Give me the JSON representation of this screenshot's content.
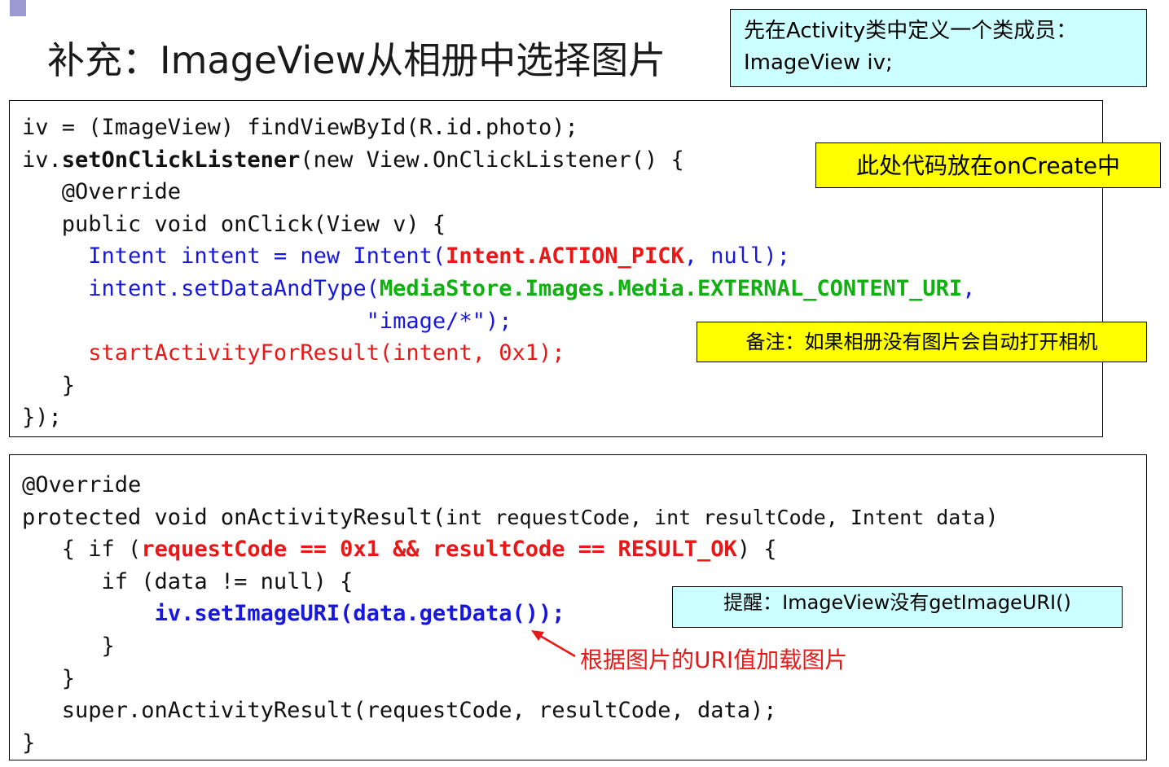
{
  "slide": {
    "title": "补充：ImageView从相册中选择图片"
  },
  "notes": {
    "member_line1": "先在Activity类中定义一个类成员：",
    "member_line2": "ImageView iv;",
    "oncreate": "此处代码放在onCreate中",
    "camera": "备注：如果相册没有图片会自动打开相机",
    "reminder": "提醒：ImageView没有getImageURI()",
    "arrow_label": "根据图片的URI值加载图片"
  },
  "code_block_1": {
    "l1": "iv = (ImageView) findViewById(R.id.photo);",
    "l2_a": "iv.",
    "l2_b": "setOnClickListener",
    "l2_c": "(new View.OnClickListener() {",
    "l3": "   @Override",
    "l4": "   public void onClick(View v) {",
    "l5_a": "     Intent intent = new Intent(",
    "l5_b": "Intent.ACTION_PICK",
    "l5_c": ", null);",
    "l6_a": "     intent.setDataAndType(",
    "l6_b": "MediaStore.Images.Media.EXTERNAL_CONTENT_URI",
    "l6_c": ",",
    "l7": "                          \"image/*\");",
    "l8": "     startActivityForResult(intent, 0x1);",
    "l9": "   }",
    "l10": "});"
  },
  "code_block_2": {
    "l1": "@Override",
    "l2_a": "protected void onActivityResult(",
    "l2_b": "int requestCode, int resultCode, Intent data",
    "l2_c": ")",
    "l3_a": "   { if (",
    "l3_b": "requestCode == 0x1 && resultCode == RESULT_OK",
    "l3_c": ") {",
    "l4": "      if (data != null) {",
    "l5_a": "          ",
    "l5_b": "iv.setImageURI(data.getData());",
    "l6": "      }",
    "l7": "   }",
    "l8": "   super.onActivityResult(requestCode, resultCode, data);",
    "l9": "}"
  }
}
